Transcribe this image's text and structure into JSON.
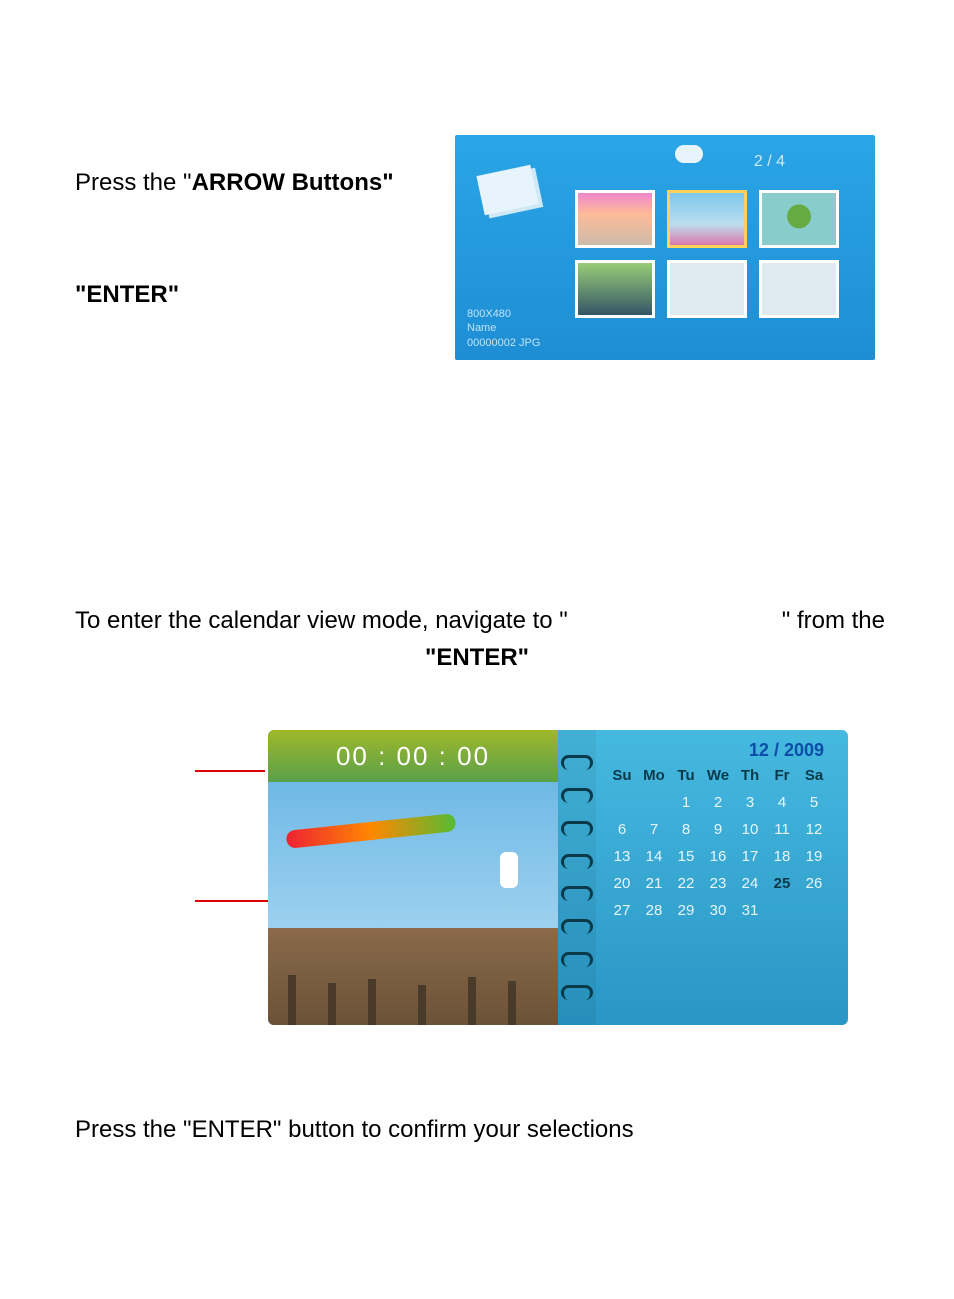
{
  "text": {
    "line1_pre": "Press the \"",
    "line1_bold": "ARROW Buttons\"",
    "enter1": "\"ENTER\"",
    "cal_line_pre": "To enter the calendar view mode, navigate to \"",
    "cal_line_post": "\" from the",
    "enter2": "\"ENTER\"",
    "bottom": "Press the \"ENTER\" button to confirm your selections"
  },
  "thumbs": {
    "counter": "2 / 4",
    "meta_res": "800X480",
    "meta_name_label": "Name",
    "meta_filename": "00000002  JPG"
  },
  "calendar": {
    "time": "00 : 00 : 00",
    "month": "12 / 2009",
    "headers": [
      "Su",
      "Mo",
      "Tu",
      "We",
      "Th",
      "Fr",
      "Sa"
    ],
    "rows": [
      [
        "",
        "",
        "1",
        "2",
        "3",
        "4",
        "5"
      ],
      [
        "6",
        "7",
        "8",
        "9",
        "10",
        "11",
        "12"
      ],
      [
        "13",
        "14",
        "15",
        "16",
        "17",
        "18",
        "19"
      ],
      [
        "20",
        "21",
        "22",
        "23",
        "24",
        "25",
        "26"
      ],
      [
        "27",
        "28",
        "29",
        "30",
        "31",
        "",
        ""
      ]
    ],
    "highlight_day": "25"
  }
}
